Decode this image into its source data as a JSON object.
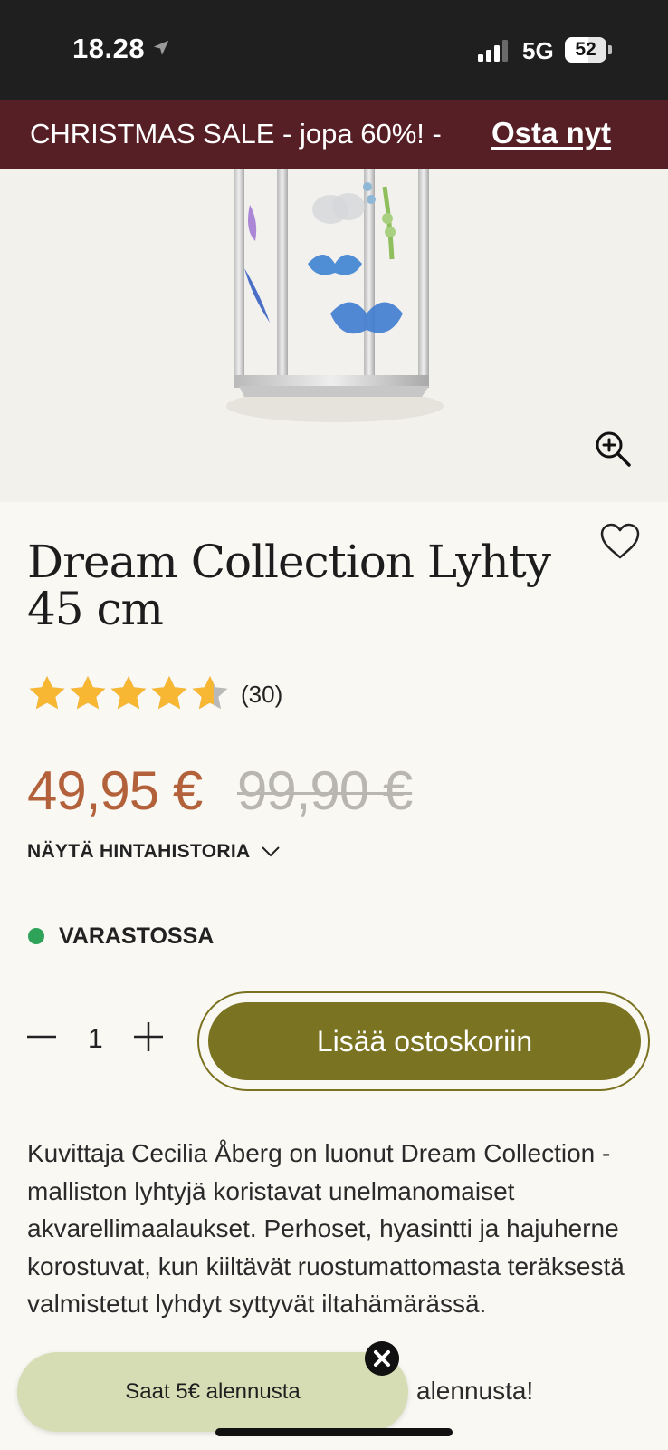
{
  "status_bar": {
    "time": "18.28",
    "network": "5G",
    "battery": "52"
  },
  "promo": {
    "text": "CHRISTMAS SALE - jopa 60%!  - ",
    "link": "Osta nyt"
  },
  "product": {
    "title": "Dream Collection Lyhty 45 cm",
    "rating": 4.6,
    "reviews": "(30)",
    "price": "49,95 €",
    "old_price": "99,90 €",
    "price_history": "NÄYTÄ HINTAHISTORIA",
    "stock": "VARASTOSSA"
  },
  "quantity": {
    "value": "1"
  },
  "cart_button": "Lisää ostoskoriin",
  "description": "Kuvittaja Cecilia Åberg on luonut Dream Collection -malliston lyhtyjä koristavat unelmanomaiset akvarellimaalaukset. Perhoset, hyasintti ja hajuherne korostuvat, kun kiiltävät ruostumattomasta teräksestä valmistetut lyhdyt syttyvät iltahämärässä.",
  "description_tail": "alennusta!",
  "popup": {
    "text": "Saat 5€ alennusta"
  },
  "colors": {
    "promo_bg": "#561f25",
    "price": "#b3613b",
    "cart_button": "#797322",
    "popup_bg": "#d6ddb4",
    "stock_dot": "#2fa35a"
  },
  "icons": [
    "location-arrow-icon",
    "signal-icon",
    "battery-icon",
    "zoom-in-icon",
    "heart-icon",
    "star-icon",
    "chevron-down-icon",
    "minus-icon",
    "plus-icon",
    "close-icon"
  ]
}
